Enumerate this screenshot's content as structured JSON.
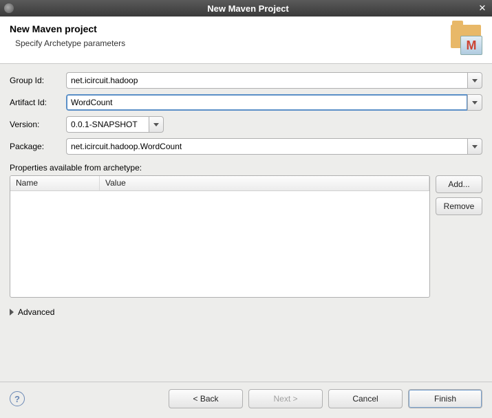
{
  "titlebar": {
    "title": "New Maven Project"
  },
  "banner": {
    "heading": "New Maven project",
    "subheading": "Specify Archetype parameters"
  },
  "form": {
    "group_id": {
      "label": "Group Id:",
      "value": "net.icircuit.hadoop"
    },
    "artifact_id": {
      "label": "Artifact Id:",
      "value": "WordCount"
    },
    "version": {
      "label": "Version:",
      "value": "0.0.1-SNAPSHOT"
    },
    "package": {
      "label": "Package:",
      "value": "net.icircuit.hadoop.WordCount"
    }
  },
  "properties": {
    "label": "Properties available from archetype:",
    "columns": {
      "name": "Name",
      "value": "Value"
    },
    "rows": []
  },
  "buttons": {
    "add": "Add...",
    "remove": "Remove",
    "back": "< Back",
    "next": "Next >",
    "cancel": "Cancel",
    "finish": "Finish"
  },
  "advanced": {
    "label": "Advanced"
  }
}
